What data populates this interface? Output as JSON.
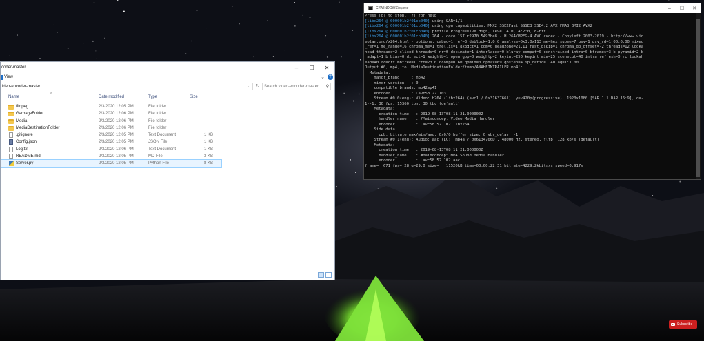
{
  "explorer": {
    "title": "coder-master",
    "ribbon_tab": "View",
    "address": "ideo-encoder-master",
    "search_placeholder": "Search video-encoder-master",
    "columns": {
      "name": "Name",
      "date": "Date modified",
      "type": "Type",
      "size": "Size"
    },
    "files": [
      {
        "name": "ffmpeg",
        "date": "2/3/2020 12:05 PM",
        "type": "File folder",
        "size": "",
        "icon": "folder-icon"
      },
      {
        "name": "GarbageFolder",
        "date": "2/3/2020 12:06 PM",
        "type": "File folder",
        "size": "",
        "icon": "folder-icon"
      },
      {
        "name": "Media",
        "date": "2/3/2020 12:06 PM",
        "type": "File folder",
        "size": "",
        "icon": "folder-icon"
      },
      {
        "name": "MediaDestinationFolder",
        "date": "2/3/2020 12:06 PM",
        "type": "File folder",
        "size": "",
        "icon": "folder-icon"
      },
      {
        "name": ".gitignore",
        "date": "2/3/2020 12:05 PM",
        "type": "Text Document",
        "size": "1 KB",
        "icon": "text-file-icon"
      },
      {
        "name": "Config.json",
        "date": "2/3/2020 12:05 PM",
        "type": "JSON File",
        "size": "1 KB",
        "icon": "json-file-icon"
      },
      {
        "name": "Log.txt",
        "date": "2/3/2020 12:06 PM",
        "type": "Text Document",
        "size": "1 KB",
        "icon": "text-file-icon"
      },
      {
        "name": "README.md",
        "date": "2/3/2020 12:05 PM",
        "type": "MD File",
        "size": "3 KB",
        "icon": "text-file-icon"
      },
      {
        "name": "Server.py",
        "date": "2/3/2020 12:05 PM",
        "type": "Python File",
        "size": "8 KB",
        "icon": "python-file-icon"
      }
    ],
    "selected_index": 8
  },
  "console": {
    "title": "C:\\WINDOWS\\py.exe",
    "lines": [
      {
        "prefix": "",
        "text": "Press [q] to stop, [?] for help"
      },
      {
        "prefix": "[libx264 @ 000001b2f01cb040]",
        "text": " using SAR=1/1"
      },
      {
        "prefix": "[libx264 @ 000001b2f01cb040]",
        "text": " using cpu capabilities: MMX2 SSE2Fast SSSE3 SSE4.2 AVX FMA3 BMI2 AVX2"
      },
      {
        "prefix": "[libx264 @ 000001b2f01cb040]",
        "text": " profile Progressive High, level 4.0, 4:2:0, 8-bit"
      },
      {
        "prefix": "[libx264 @ 000001b2f01cb040]",
        "text": " 264 - core 157 r2970 5493be8 - H.264/MPEG-4 AVC codec - Copyleft 2003-2019 - http://www.vid"
      },
      {
        "prefix": "",
        "text": "eolan.org/x264.html - options: cabac=1 ref=3 deblock=1:0:0 analyse=0x3:0x113 me=hex subme=7 psy=1 psy_rd=1.00:0.00 mixed"
      },
      {
        "prefix": "",
        "text": "_ref=1 me_range=16 chroma_me=1 trellis=1 8x8dct=1 cqm=0 deadzone=21,11 fast_pskip=1 chroma_qp_offset=-2 threads=12 looka"
      },
      {
        "prefix": "",
        "text": "head_threads=2 sliced_threads=0 nr=0 decimate=1 interlaced=0 bluray_compat=0 constrained_intra=0 bframes=3 b_pyramid=2 b"
      },
      {
        "prefix": "",
        "text": "_adapt=1 b_bias=0 direct=1 weightb=1 open_gop=0 weightp=2 keyint=250 keyint_min=25 scenecut=40 intra_refresh=0 rc_lookah"
      },
      {
        "prefix": "",
        "text": "ead=40 rc=crf mbtree=1 crf=23.0 qcomp=0.60 qpmin=0 qpmax=69 qpstep=4 ip_ratio=1.40 aq=1:1.00"
      },
      {
        "prefix": "",
        "text": "Output #0, mp4, to 'MediaDestinationFolder/temp/ANAHEIMTRAILER.mp4':"
      },
      {
        "prefix": "",
        "text": "  Metadata:"
      },
      {
        "prefix": "",
        "text": "    major_brand     : mp42"
      },
      {
        "prefix": "",
        "text": "    minor_version   : 0"
      },
      {
        "prefix": "",
        "text": "    compatible_brands: mp42mp41"
      },
      {
        "prefix": "",
        "text": "    encoder         : Lavf58.27.103"
      },
      {
        "prefix": "",
        "text": "    Stream #0:0(eng): Video: h264 (libx264) (avc1 / 0x31637661), yuv420p(progressive), 1920x1080 [SAR 1:1 DAR 16:9], q=-"
      },
      {
        "prefix": "",
        "text": "1--1, 30 fps, 15360 tbn, 30 tbc (default)"
      },
      {
        "prefix": "",
        "text": "    Metadata:"
      },
      {
        "prefix": "",
        "text": "      creation_time   : 2019-08-13T08:11:21.000000Z"
      },
      {
        "prefix": "",
        "text": "      handler_name    : ?Mainconcept Video Media Handler"
      },
      {
        "prefix": "",
        "text": "      encoder         : Lavc58.52.102 libx264"
      },
      {
        "prefix": "",
        "text": "    Side data:"
      },
      {
        "prefix": "",
        "text": "      cpb: bitrate max/min/avg: 0/0/0 buffer size: 0 vbv_delay: -1"
      },
      {
        "prefix": "",
        "text": "    Stream #0:1(eng): Audio: aac (LC) (mp4a / 0x6134706D), 48000 Hz, stereo, fltp, 128 kb/s (default)"
      },
      {
        "prefix": "",
        "text": "    Metadata:"
      },
      {
        "prefix": "",
        "text": "      creation_time   : 2019-08-13T08:11:21.000000Z"
      },
      {
        "prefix": "",
        "text": "      handler_name    : #Mainconcept MP4 Sound Media Handler"
      },
      {
        "prefix": "",
        "text": "      encoder         : Lavc58.52.102 aac"
      },
      {
        "prefix": "",
        "text": "frame=  671 fps= 28 q=29.0 size=   11520kB time=00:00:22.31 bitrate=4229.2kbits/s speed=0.917x"
      }
    ]
  },
  "subscribe": {
    "label": "Subscribe"
  },
  "colors": {
    "console_bg": "#0c0c0c",
    "console_prefix": "#3a96dd",
    "tent_glow": "#7ee23a",
    "folder": "#f3c74f",
    "selection": "#99d1ff",
    "subscribe_bg": "#cc1f1f"
  }
}
